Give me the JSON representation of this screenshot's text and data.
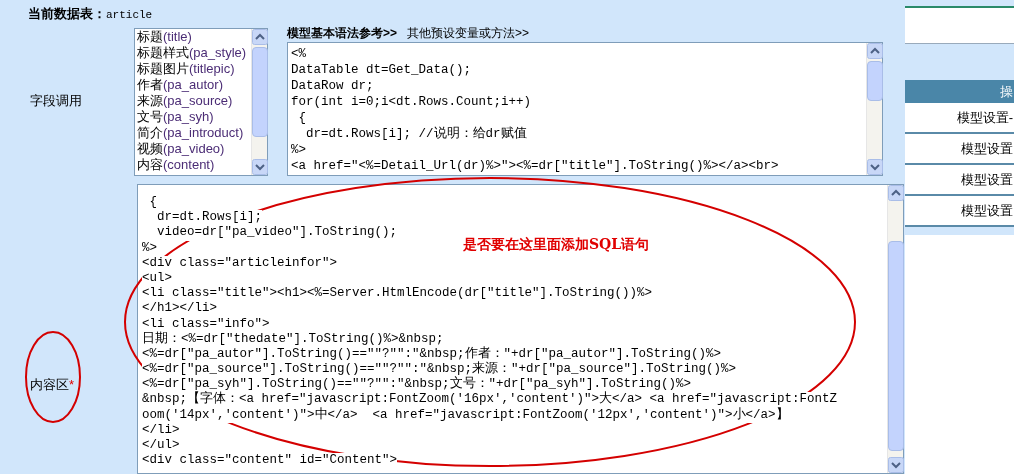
{
  "header": {
    "label": "当前数据表：",
    "table": "article"
  },
  "field_section": {
    "label": "字段调用",
    "fields": [
      {
        "name": "标题",
        "field": "(title)"
      },
      {
        "name": "标题样式",
        "field": "(pa_style)"
      },
      {
        "name": "标题图片",
        "field": "(titlepic)"
      },
      {
        "name": "作者",
        "field": "(pa_autor)"
      },
      {
        "name": "来源",
        "field": "(pa_source)"
      },
      {
        "name": "文号",
        "field": "(pa_syh)"
      },
      {
        "name": "简介",
        "field": "(pa_introduct)"
      },
      {
        "name": "视频",
        "field": "(pa_video)"
      },
      {
        "name": "内容",
        "field": "(content)"
      }
    ],
    "tabs": [
      {
        "label": "模型基本语法参考>>",
        "selected": true
      },
      {
        "label": "其他预设变量或方法>>",
        "selected": false
      }
    ],
    "code_lines": [
      "<%",
      "DataTable dt=Get_Data();",
      "DataRow dr;",
      "for(int i=0;i<dt.Rows.Count;i++)",
      " {",
      "  dr=dt.Rows[i]; //说明：给dr赋值",
      "%>",
      "<a href=\"<%=Detail_Url(dr)%>\"><%=dr[\"title\"].ToString()%></a><br>"
    ]
  },
  "content_section": {
    "label": "内容区",
    "required_mark": "*",
    "code_lines": [
      " {",
      "  dr=dt.Rows[i];",
      "  video=dr[\"pa_video\"].ToString();",
      "%>",
      "<div class=\"articleinfor\">",
      "<ul>",
      "<li class=\"title\"><h1><%=Server.HtmlEncode(dr[\"title\"].ToString())%>",
      "</h1></li>",
      "<li class=\"info\">",
      "日期：<%=dr[\"thedate\"].ToString()%>&nbsp;",
      "<%=dr[\"pa_autor\"].ToString()==\"\"?\"\":\"&nbsp;作者：\"+dr[\"pa_autor\"].ToString()%>",
      "<%=dr[\"pa_source\"].ToString()==\"\"?\"\":\"&nbsp;来源：\"+dr[\"pa_source\"].ToString()%>",
      "<%=dr[\"pa_syh\"].ToString()==\"\"?\"\":\"&nbsp;文号：\"+dr[\"pa_syh\"].ToString()%>",
      "&nbsp;【字体：<a href=\"javascript:FontZoom('16px','content')\">大</a> <a href=\"javascript:FontZ",
      "oom('14px','content')\">中</a>  <a href=\"javascript:FontZoom('12px','content')\">小</a>】",
      "</li>",
      "</ul>",
      "<div class=\"content\" id=\"Content\">"
    ]
  },
  "annotation": {
    "text": "是否要在这里面添加SQL语句"
  },
  "sidebar": {
    "header": "操",
    "items": [
      "模型设置-",
      "模型设置",
      "模型设置",
      "模型设置"
    ]
  }
}
